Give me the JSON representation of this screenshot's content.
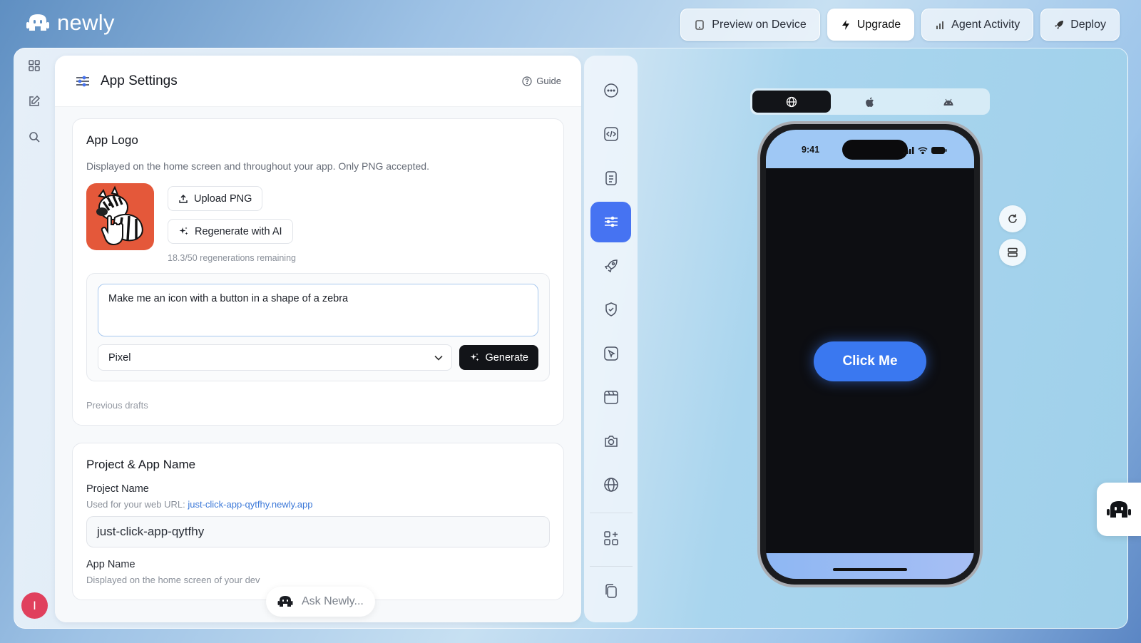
{
  "app": {
    "name": "newly"
  },
  "header": {
    "buttons": [
      {
        "label": "Preview on Device",
        "icon": "device-icon"
      },
      {
        "label": "Upgrade",
        "icon": "bolt-icon"
      },
      {
        "label": "Agent Activity",
        "icon": "bar-chart-icon"
      },
      {
        "label": "Deploy",
        "icon": "rocket-icon"
      }
    ]
  },
  "left_rail": {
    "items": [
      "grid-icon",
      "edit-icon",
      "search-icon"
    ],
    "avatar_initial": "I"
  },
  "settings": {
    "title": "App Settings",
    "guide_label": "Guide",
    "logo_card": {
      "title": "App Logo",
      "description": "Displayed on the home screen and throughout your app. Only PNG accepted.",
      "upload_label": "Upload PNG",
      "regenerate_label": "Regenerate with AI",
      "regen_note": "18.3/50 regenerations remaining",
      "prompt_value": "Make me an icon with a button in a shape of a zebra",
      "style_selected": "Pixel",
      "generate_label": "Generate",
      "drafts_label": "Previous drafts"
    },
    "name_card": {
      "title": "Project & App Name",
      "project_label": "Project Name",
      "project_help": "Used for your web URL: ",
      "project_url": "just-click-app-qytfhy.newly.app",
      "project_value": "just-click-app-qytfhy",
      "app_label": "App Name",
      "app_help": "Displayed on the home screen of your dev"
    }
  },
  "ask": {
    "placeholder": "Ask Newly..."
  },
  "tools": {
    "items": [
      "chat-icon",
      "code-icon",
      "document-icon",
      "sliders-icon",
      "rocket-icon",
      "shield-check-icon",
      "cursor-icon",
      "calendar-icon",
      "camera-icon",
      "globe-icon",
      "apps-add-icon",
      "copy-icon"
    ],
    "active": "sliders-icon"
  },
  "preview": {
    "os_options": [
      "globe-icon",
      "apple-icon",
      "android-icon"
    ],
    "active_os": "globe-icon",
    "status_time": "9:41",
    "button_label": "Click Me",
    "colors": {
      "accent": "#4673f2",
      "button": "#3a78f0",
      "screen": "#0d0e12"
    }
  }
}
